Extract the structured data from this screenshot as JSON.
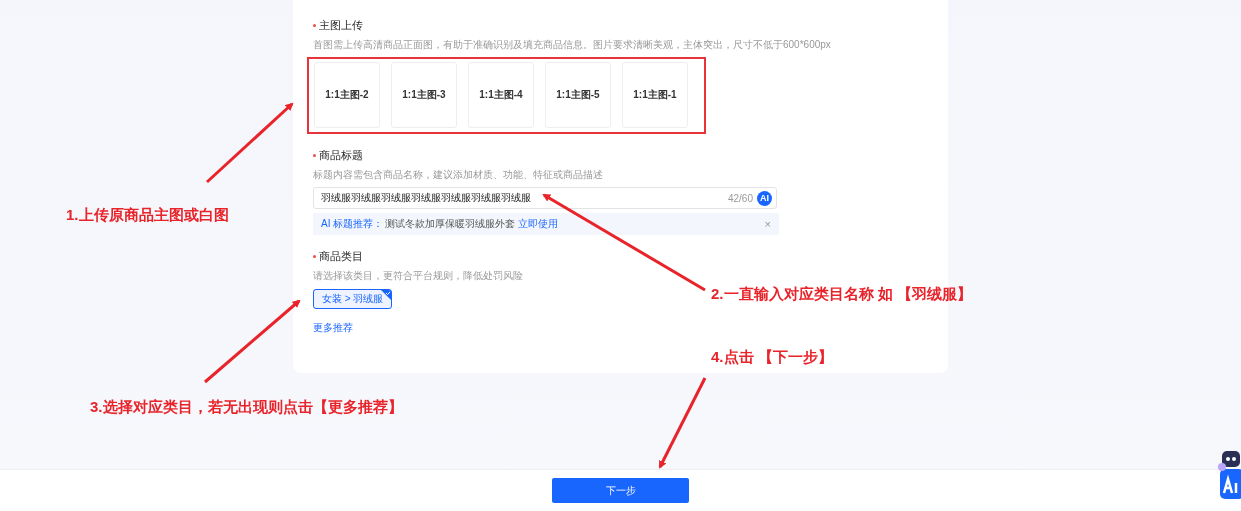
{
  "main_images": {
    "title": "主图上传",
    "required": true,
    "hint": "首图需上传高清商品正面图，有助于准确识别及填充商品信息。图片要求清晰美观，主体突出，尺寸不低于600*600px",
    "highlighted": true,
    "slots": [
      {
        "label": "1:1主图-2"
      },
      {
        "label": "1:1主图-3"
      },
      {
        "label": "1:1主图-4"
      },
      {
        "label": "1:1主图-5"
      },
      {
        "label": "1:1主图-1"
      }
    ]
  },
  "product_title": {
    "title": "商品标题",
    "required": true,
    "hint": "标题内容需包含商品名称，建议添加材质、功能、特征或商品描述",
    "value": "羽绒服羽绒服羽绒服羽绒服羽绒服羽绒服羽绒服",
    "counter": "42/60",
    "ai_badge": "AI",
    "suggestion": {
      "label": "AI 标题推荐：",
      "text": "测试冬款加厚保暖羽绒服外套",
      "action": "立即使用",
      "close": "×"
    }
  },
  "category": {
    "title": "商品类目",
    "required": true,
    "hint": "请选择该类目，更符合平台规则，降低处罚风险",
    "options": [
      {
        "label": "女装 > 羽绒服",
        "selected": true
      }
    ],
    "more": "更多推荐"
  },
  "next_button": "下一步",
  "annotations": [
    {
      "text": "1.上传原商品主图或白图"
    },
    {
      "text": "2.一直输入对应类目名称 如 【羽绒服】"
    },
    {
      "text": "3.选择对应类目，若无出现则点击【更多推荐】"
    },
    {
      "text": "4.点击 【下一步】"
    }
  ]
}
